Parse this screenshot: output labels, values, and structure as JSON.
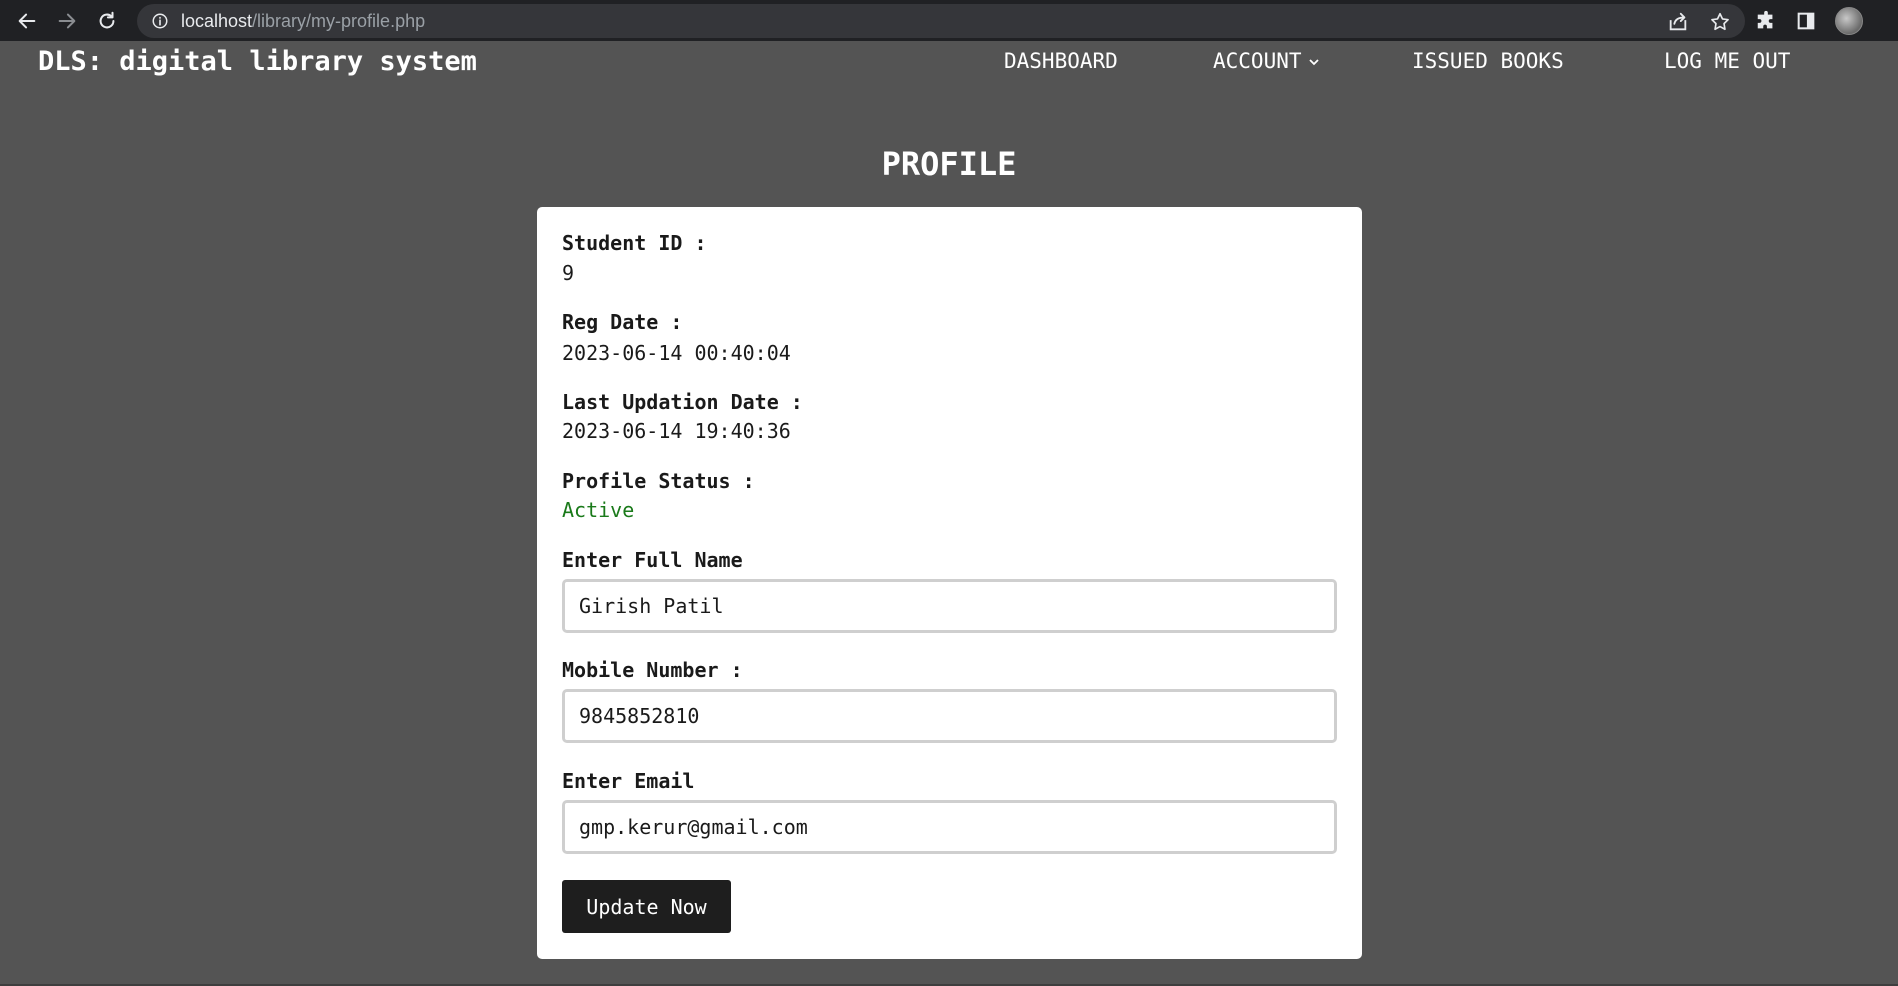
{
  "browser": {
    "url_host": "localhost",
    "url_path": "/library/my-profile.php"
  },
  "site": {
    "brand": "DLS: digital library system",
    "menu": [
      {
        "label": "DASHBOARD"
      },
      {
        "label": "ACCOUNT"
      },
      {
        "label": "ISSUED BOOKS"
      },
      {
        "label": "LOG ME OUT"
      }
    ]
  },
  "profile": {
    "title": "PROFILE",
    "student_id_label": "Student ID :",
    "student_id": "9",
    "reg_date_label": "Reg Date :",
    "reg_date": "2023-06-14 00:40:04",
    "last_update_label": "Last Updation Date :",
    "last_update": "2023-06-14 19:40:36",
    "status_label": "Profile Status :",
    "status": "Active",
    "status_color": "#1a7a1a",
    "full_name_label": "Enter Full Name",
    "full_name": "Girish Patil",
    "mobile_label": "Mobile Number :",
    "mobile": "9845852810",
    "email_label": "Enter Email",
    "email": "gmp.kerur@gmail.com",
    "submit_label": "Update Now"
  },
  "icons": {
    "back": "arrow-left-icon",
    "forward": "arrow-right-icon",
    "reload": "reload-icon",
    "site_info": "info-icon",
    "share": "share-icon",
    "bookmark": "star-icon",
    "extensions": "puzzle-icon",
    "side_panel": "side-panel-icon",
    "profile": "avatar",
    "menu_caret": "chevron-down-icon"
  }
}
